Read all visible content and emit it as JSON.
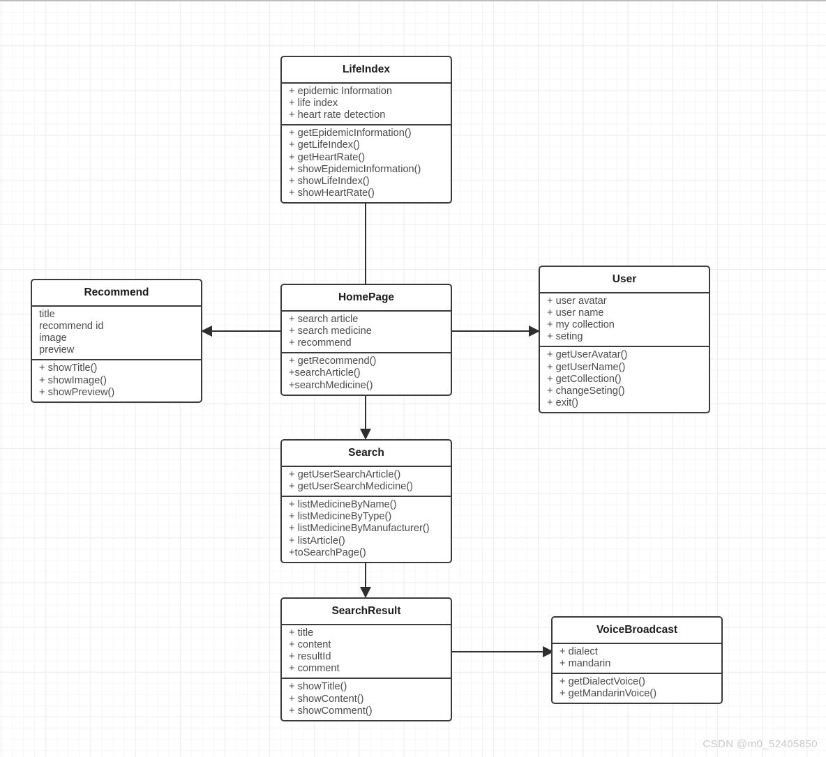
{
  "diagram": {
    "type": "uml-class-diagram",
    "watermark": "CSDN @m0_52405850",
    "colors": {
      "box_border": "#3a3a3a",
      "connector": "#2e2e2e",
      "title_text": "#1c1c1c",
      "member_text": "#4a4a4a",
      "grid_minor": "#f6f6f6",
      "grid_major": "#ededed",
      "watermark": "#c9c9c9",
      "background": "#ffffff"
    },
    "classes": [
      {
        "id": "lifeindex",
        "name": "LifeIndex",
        "attributes": [
          "+ epidemic Information",
          "+ life index",
          "+ heart rate detection"
        ],
        "methods": [
          "+ getEpidemicInformation()",
          "+ getLifeIndex()",
          "+ getHeartRate()",
          "+ showEpidemicInformation()",
          "+ showLifeIndex()",
          "+ showHeartRate()"
        ]
      },
      {
        "id": "recommend",
        "name": "Recommend",
        "attributes": [
          "title",
          "recommend id",
          "image",
          "preview"
        ],
        "methods": [
          "+ showTitle()",
          "+ showImage()",
          "+ showPreview()"
        ]
      },
      {
        "id": "homepage",
        "name": "HomePage",
        "attributes": [
          "+ search article",
          "+ search medicine",
          "+ recommend"
        ],
        "methods": [
          "+ getRecommend()",
          "+searchArticle()",
          "+searchMedicine()"
        ]
      },
      {
        "id": "user",
        "name": "User",
        "attributes": [
          "+ user avatar",
          "+ user name",
          "+ my collection",
          "+ seting"
        ],
        "methods": [
          "+ getUserAvatar()",
          "+ getUserName()",
          "+ getCollection()",
          "+ changeSeting()",
          "+ exit()"
        ]
      },
      {
        "id": "search",
        "name": "Search",
        "attributes": [
          "+ getUserSearchArticle()",
          "+ getUserSearchMedicine()"
        ],
        "methods": [
          "+ listMedicineByName()",
          "+ listMedicineByType()",
          "+ listMedicineByManufacturer()",
          "+ listArticle()",
          "+toSearchPage()"
        ]
      },
      {
        "id": "searchresult",
        "name": "SearchResult",
        "attributes": [
          "+ title",
          "+ content",
          "+ resultId",
          "+ comment"
        ],
        "methods": [
          "+ showTitle()",
          "+ showContent()",
          "+ showComment()"
        ]
      },
      {
        "id": "voicebroadcast",
        "name": "VoiceBroadcast",
        "attributes": [
          "+ dialect",
          "+ mandarin"
        ],
        "methods": [
          "+ getDialectVoice()",
          "+ getMandarinVoice()"
        ]
      }
    ],
    "connections": [
      {
        "from": "homepage",
        "to": "lifeindex",
        "direction": "up"
      },
      {
        "from": "homepage",
        "to": "recommend",
        "direction": "left"
      },
      {
        "from": "homepage",
        "to": "user",
        "direction": "right"
      },
      {
        "from": "homepage",
        "to": "search",
        "direction": "down"
      },
      {
        "from": "search",
        "to": "searchresult",
        "direction": "down"
      },
      {
        "from": "searchresult",
        "to": "voicebroadcast",
        "direction": "right"
      }
    ]
  }
}
